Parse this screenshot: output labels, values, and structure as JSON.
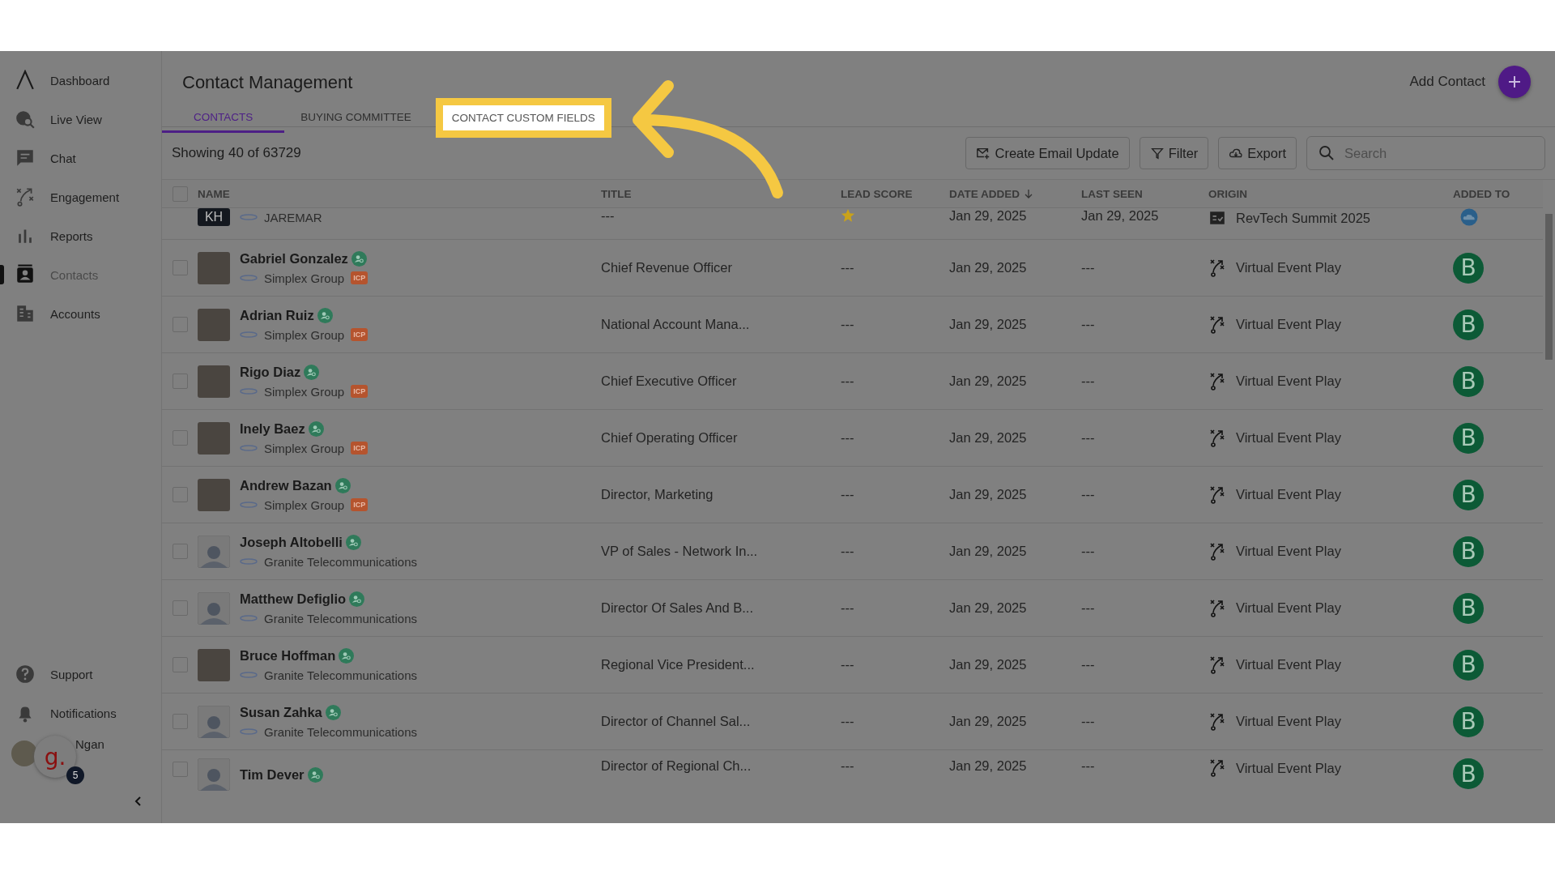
{
  "sidebar": {
    "items": [
      {
        "label": "Dashboard",
        "selected": false
      },
      {
        "label": "Live View",
        "selected": false
      },
      {
        "label": "Chat",
        "selected": false
      },
      {
        "label": "Engagement",
        "selected": false
      },
      {
        "label": "Reports",
        "selected": false
      },
      {
        "label": "Contacts",
        "selected": true
      },
      {
        "label": "Accounts",
        "selected": false
      }
    ],
    "bottom_items": [
      {
        "label": "Support"
      },
      {
        "label": "Notifications"
      }
    ],
    "user": {
      "name": "Ngan",
      "logo": "g.",
      "badge": "5"
    }
  },
  "header": {
    "title": "Contact Management",
    "add_label": "Add Contact"
  },
  "tabs": [
    {
      "label": "CONTACTS",
      "selected": true,
      "highlighted": false
    },
    {
      "label": "BUYING COMMITTEE",
      "selected": false,
      "highlighted": false
    },
    {
      "label": "CONTACT CUSTOM FIELDS",
      "selected": false,
      "highlighted": true
    }
  ],
  "toolbar": {
    "showing": "Showing 40 of  63729",
    "buttons": [
      {
        "label": "Create Email Update"
      },
      {
        "label": "Filter"
      },
      {
        "label": "Export"
      }
    ],
    "search": {
      "placeholder": "Search"
    }
  },
  "table": {
    "all_checked": false,
    "columns": [
      {
        "label": "NAME",
        "sorted": false
      },
      {
        "label": "TITLE",
        "sorted": false
      },
      {
        "label": "LEAD SCORE",
        "sorted": false
      },
      {
        "label": "DATE ADDED",
        "sorted": true
      },
      {
        "label": "LAST SEEN",
        "sorted": false
      },
      {
        "label": "ORIGIN",
        "sorted": false
      },
      {
        "label": "ADDED TO",
        "sorted": false
      }
    ],
    "rows": [
      {
        "kind": "cut_top",
        "initials": "KH",
        "company": "JAREMAR",
        "title": "---",
        "starred": true,
        "date_added": "Jan 29, 2025",
        "last_seen": "Jan 29, 2025",
        "origin": "RevTech Summit 2025"
      },
      {
        "kind": "photo",
        "checked": false,
        "name": "Gabriel Gonzalez",
        "company": "Simplex Group",
        "tag": "ICP",
        "title": "Chief Revenue Officer",
        "lead_score": "---",
        "date_added": "Jan 29, 2025",
        "last_seen": "---",
        "origin": "Virtual Event Play",
        "added_letter": "B"
      },
      {
        "kind": "photo",
        "checked": false,
        "name": "Adrian Ruiz",
        "company": "Simplex Group",
        "tag": "ICP",
        "title": "National Account Mana...",
        "lead_score": "---",
        "date_added": "Jan 29, 2025",
        "last_seen": "---",
        "origin": "Virtual Event Play",
        "added_letter": "B"
      },
      {
        "kind": "photo",
        "checked": false,
        "name": "Rigo Diaz",
        "company": "Simplex Group",
        "tag": "ICP",
        "title": "Chief Executive Officer",
        "lead_score": "---",
        "date_added": "Jan 29, 2025",
        "last_seen": "---",
        "origin": "Virtual Event Play",
        "added_letter": "B"
      },
      {
        "kind": "photo",
        "checked": false,
        "name": "Inely Baez",
        "company": "Simplex Group",
        "tag": "ICP",
        "title": "Chief Operating Officer",
        "lead_score": "---",
        "date_added": "Jan 29, 2025",
        "last_seen": "---",
        "origin": "Virtual Event Play",
        "added_letter": "B"
      },
      {
        "kind": "photo",
        "checked": false,
        "name": "Andrew Bazan",
        "company": "Simplex Group",
        "tag": "ICP",
        "title": "Director, Marketing",
        "lead_score": "---",
        "date_added": "Jan 29, 2025",
        "last_seen": "---",
        "origin": "Virtual Event Play",
        "added_letter": "B"
      },
      {
        "kind": "silhouette",
        "checked": false,
        "name": "Joseph Altobelli",
        "company": "Granite Telecommunications",
        "title": "VP of Sales - Network In...",
        "lead_score": "---",
        "date_added": "Jan 29, 2025",
        "last_seen": "---",
        "origin": "Virtual Event Play",
        "added_letter": "B"
      },
      {
        "kind": "silhouette",
        "checked": false,
        "name": "Matthew Defiglio",
        "company": "Granite Telecommunications",
        "title": "Director Of Sales And B...",
        "lead_score": "---",
        "date_added": "Jan 29, 2025",
        "last_seen": "---",
        "origin": "Virtual Event Play",
        "added_letter": "B"
      },
      {
        "kind": "photo",
        "checked": false,
        "name": "Bruce Hoffman",
        "company": "Granite Telecommunications",
        "title": "Regional Vice President...",
        "lead_score": "---",
        "date_added": "Jan 29, 2025",
        "last_seen": "---",
        "origin": "Virtual Event Play",
        "added_letter": "B"
      },
      {
        "kind": "silhouette",
        "checked": false,
        "name": "Susan Zahka",
        "company": "Granite Telecommunications",
        "title": "Director of Channel Sal...",
        "lead_score": "---",
        "date_added": "Jan 29, 2025",
        "last_seen": "---",
        "origin": "Virtual Event Play",
        "added_letter": "B"
      },
      {
        "kind": "cut_bottom",
        "checked": false,
        "name": "Tim Dever",
        "title": "Director of Regional Ch...",
        "lead_score": "---",
        "date_added": "Jan 29, 2025",
        "last_seen": "---",
        "origin": "Virtual Event Play",
        "added_letter": "B"
      }
    ]
  }
}
